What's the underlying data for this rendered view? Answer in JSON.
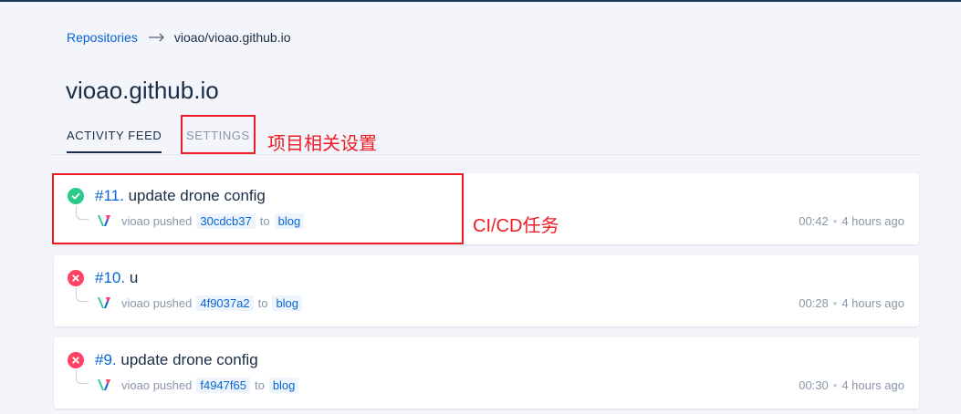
{
  "breadcrumb": {
    "repositories_label": "Repositories",
    "current": "vioao/vioao.github.io"
  },
  "page": {
    "title": "vioao.github.io"
  },
  "tabs": [
    {
      "label": "ACTIVITY FEED",
      "active": true
    },
    {
      "label": "SETTINGS",
      "active": false
    }
  ],
  "annotations": {
    "settings_note": "项目相关设置",
    "ci_note": "CI/CD任务",
    "color": "#ee1c25"
  },
  "builds": [
    {
      "status": "success",
      "number": "#11.",
      "message": "update drone config",
      "author": "vioao",
      "action": "pushed",
      "commit": "30cdcb37",
      "to_word": "to",
      "branch": "blog",
      "duration": "00:42",
      "age": "4 hours ago"
    },
    {
      "status": "failure",
      "number": "#10.",
      "message": "u",
      "author": "vioao",
      "action": "pushed",
      "commit": "4f9037a2",
      "to_word": "to",
      "branch": "blog",
      "duration": "00:28",
      "age": "4 hours ago"
    },
    {
      "status": "failure",
      "number": "#9.",
      "message": "update drone config",
      "author": "vioao",
      "action": "pushed",
      "commit": "f4947f65",
      "to_word": "to",
      "branch": "blog",
      "duration": "00:30",
      "age": "4 hours ago"
    }
  ],
  "icons": {
    "success": "check-icon",
    "failure": "x-icon",
    "avatar": "v-logo-avatar",
    "breadcrumb_separator": "arrow-right-icon"
  },
  "colors": {
    "success": "#2bca8b",
    "failure": "#ff4164",
    "link": "#0564d7"
  }
}
